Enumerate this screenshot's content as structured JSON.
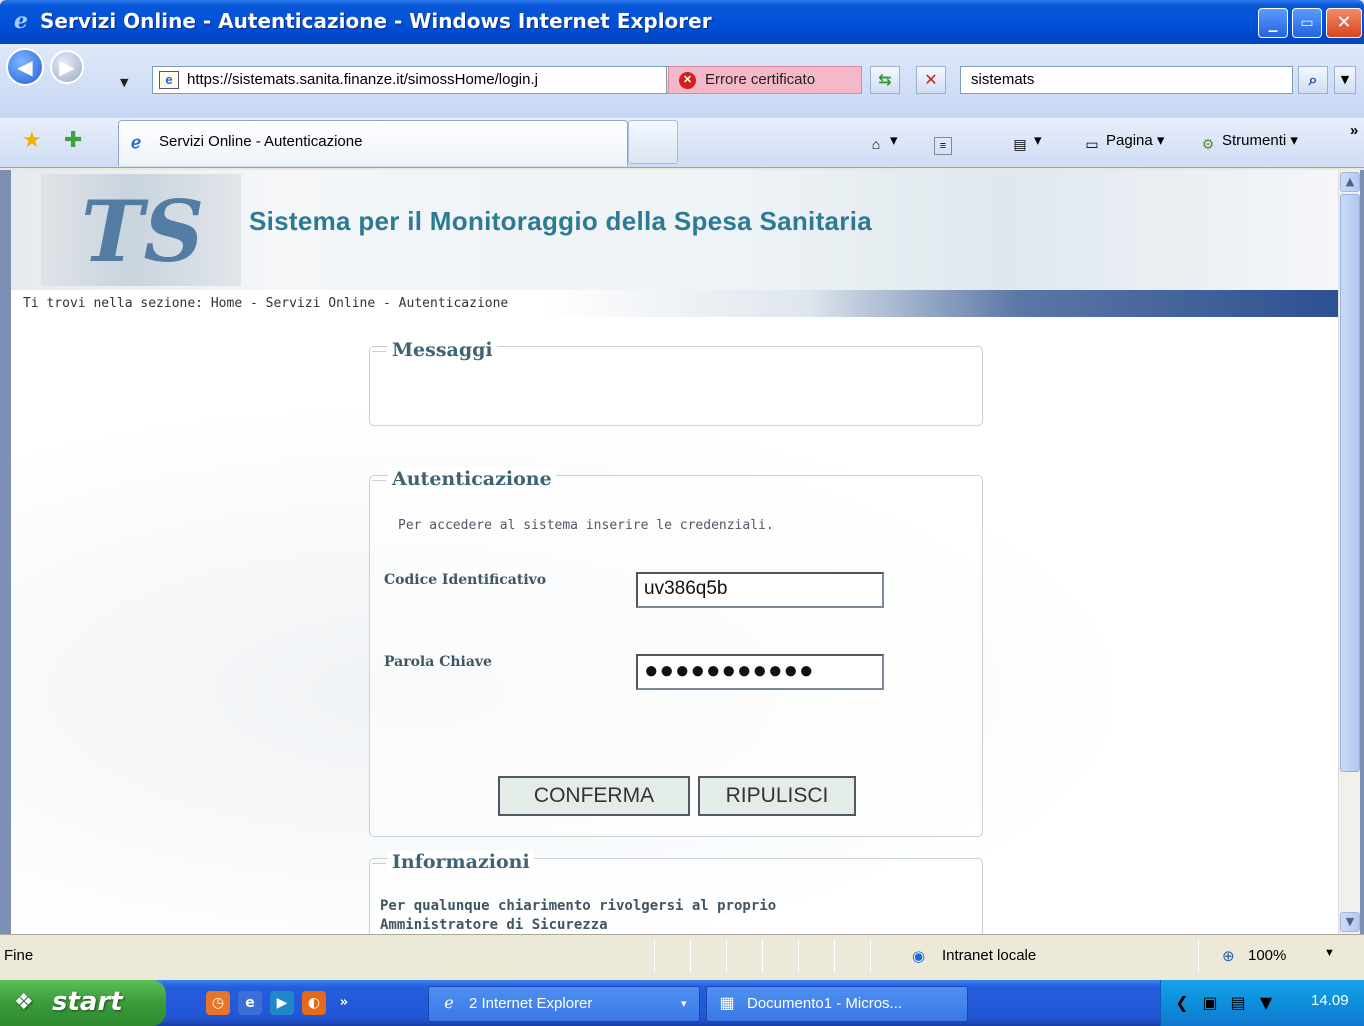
{
  "window": {
    "title": "Servizi Online - Autenticazione - Windows Internet Explorer",
    "minimize": "_",
    "restore": "▭",
    "close": "✕"
  },
  "address": {
    "url": "https://sistemats.sanita.finanze.it/simossHome/login.j",
    "cert_error": "Errore certificato",
    "search_value": "sistemats"
  },
  "tabs": {
    "active_label": "Servizi Online - Autenticazione"
  },
  "commandbar": {
    "page_label": "Pagina",
    "tools_label": "Strumenti",
    "more": "»"
  },
  "site": {
    "logo_text": "TS",
    "title": "Sistema per il Monitoraggio della Spesa Sanitaria",
    "breadcrumb": "Ti trovi nella sezione: Home - Servizi Online - Autenticazione"
  },
  "messages": {
    "legend": "Messaggi"
  },
  "auth": {
    "legend": "Autenticazione",
    "hint": "Per accedere al sistema inserire le credenziali.",
    "user_label": "Codice Identificativo",
    "user_value": "uv386q5b",
    "password_label": "Parola Chiave",
    "password_mask": "●●●●●●●●●●●",
    "confirm_button": "CONFERMA",
    "clear_button": "RIPULISCI"
  },
  "info": {
    "legend": "Informazioni",
    "text": "Per qualunque chiarimento rivolgersi al proprio Amministratore di Sicurezza"
  },
  "status": {
    "text": "Fine",
    "zone": "Intranet locale",
    "zoom": "100%"
  },
  "taskbar": {
    "start": "start",
    "ie_group": "2 Internet Explorer",
    "word_doc": "Documento1 - Micros...",
    "clock": "14.09",
    "ql_more": "»"
  }
}
